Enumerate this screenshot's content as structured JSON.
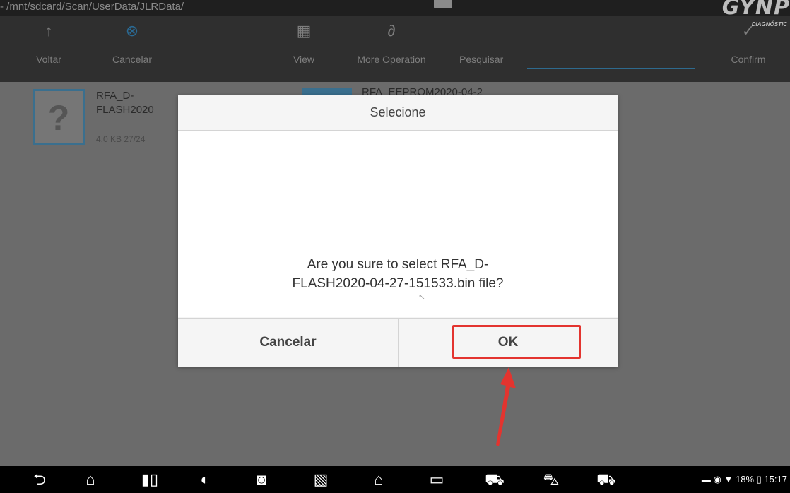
{
  "path_bar": {
    "path": "- /mnt/sdcard/Scan/UserData/JLRData/"
  },
  "logo": {
    "brand": "GYNP",
    "sub": "DIAGNÓSTIC"
  },
  "toolbar": {
    "back": {
      "icon": "arrow-up-icon",
      "label": "Voltar"
    },
    "cancel": {
      "icon": "close-circle-icon",
      "label": "Cancelar"
    },
    "view": {
      "icon": "grid-icon",
      "label": "View"
    },
    "more": {
      "icon": "link-icon",
      "label": "More Operation"
    },
    "search": {
      "label": "Pesquisar",
      "value": ""
    },
    "confirm": {
      "icon": "check-icon",
      "label": "Confirm"
    }
  },
  "files": [
    {
      "name_line1": "RFA_D-",
      "name_line2": "FLASH2020",
      "meta": "4.0 KB    27/24"
    },
    {
      "name": "RFA_EEPROM2020-04-2"
    }
  ],
  "dialog": {
    "title": "Selecione",
    "message_line1": "Are you sure to select RFA_D-",
    "message_line2": "FLASH2020-04-27-151533.bin file?",
    "cancel_label": "Cancelar",
    "ok_label": "OK"
  },
  "colors": {
    "highlight": "#e3342f",
    "accent": "#3a6f8e"
  },
  "status_bar": {
    "battery": "18%",
    "time": "15:17"
  }
}
